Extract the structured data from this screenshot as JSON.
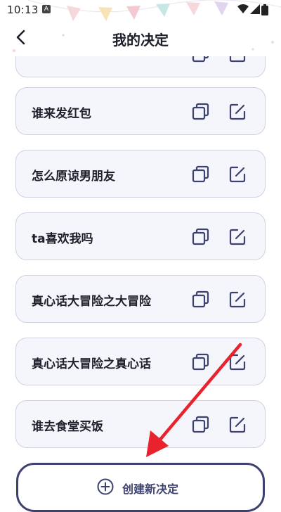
{
  "status_bar": {
    "time": "10:13"
  },
  "header": {
    "title": "我的决定"
  },
  "decisions": [
    {
      "label": ""
    },
    {
      "label": "谁来发红包"
    },
    {
      "label": "怎么原谅男朋友"
    },
    {
      "label": "ta喜欢我吗"
    },
    {
      "label": "真心话大冒险之大冒险"
    },
    {
      "label": "真心话大冒险之真心话"
    },
    {
      "label": "谁去食堂买饭"
    }
  ],
  "create_button": {
    "label": "创建新决定"
  },
  "colors": {
    "accent": "#3c4170",
    "card_bg": "#f4f6fb",
    "card_border": "#cfd3e0",
    "annotation_arrow": "#e8232e"
  }
}
